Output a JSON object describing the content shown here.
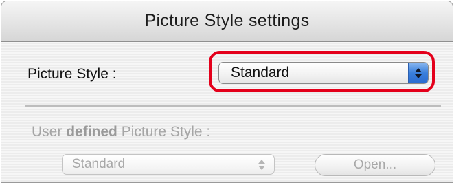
{
  "window": {
    "title": "Picture Style settings"
  },
  "picture_style": {
    "label": "Picture Style :",
    "selected": "Standard"
  },
  "user_defined": {
    "label_prefix": "User",
    "label_bold": "defined",
    "label_suffix": "Picture Style :",
    "selected": "Standard",
    "enabled": false,
    "open_button_label": "Open..."
  },
  "colors": {
    "highlight": "#e4001b",
    "popup_arrow_accent": "#3a7fdc",
    "disabled_text": "#a5a5a5"
  },
  "icons": {
    "popup_arrows": "up-down-chevron-icon"
  }
}
